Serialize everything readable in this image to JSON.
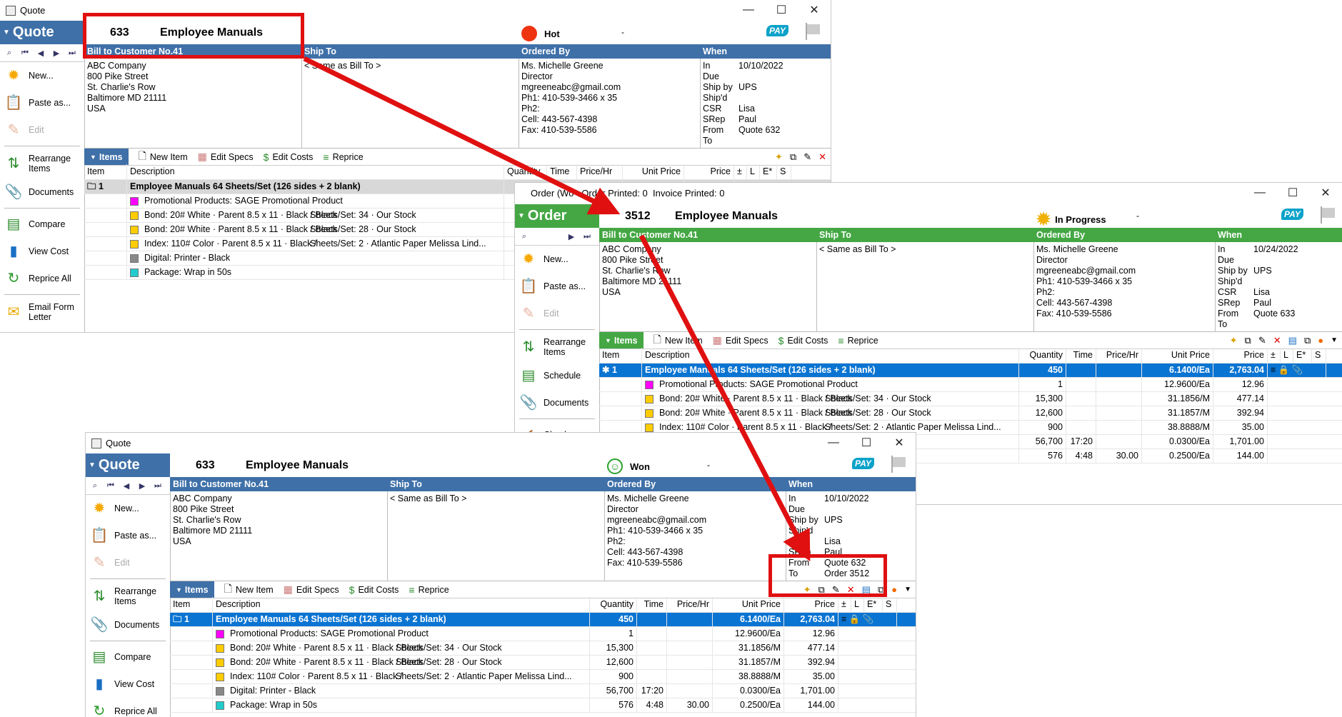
{
  "colors": {
    "quote_blue": "#3f70a8",
    "order_green": "#44a744",
    "annot_red": "#e01010",
    "sel_blue": "#0a74d2"
  },
  "quote_top": {
    "title": "Quote",
    "doc_label": "Quote",
    "number": "633",
    "job": "Employee Manuals",
    "status": "Hot",
    "status_icon": "red-circle-icon",
    "status_dash": "-",
    "pay": "PAY",
    "bill_to_header": "Bill to Customer No.41",
    "ship_to_header": "Ship To",
    "ordered_by_header": "Ordered By",
    "when_header": "When",
    "bill_to": [
      "ABC Company",
      "800 Pike Street",
      "St. Charlie's Row",
      "Baltimore MD 21111",
      "USA"
    ],
    "ship_to": "< Same as Bill To >",
    "ordered_by": [
      "Ms. Michelle Greene",
      "Director",
      "mgreeneabc@gmail.com",
      "Ph1: 410-539-3466 x 35",
      "Ph2:",
      "Cell: 443-567-4398",
      "Fax: 410-539-5586"
    ],
    "when": [
      [
        "In",
        "10/10/2022"
      ],
      [
        "Due",
        ""
      ],
      [
        "Ship by",
        "UPS"
      ],
      [
        "Ship'd",
        ""
      ],
      [
        "CSR",
        "Lisa"
      ],
      [
        "SRep",
        "Paul"
      ],
      [
        "From",
        "Quote 632"
      ],
      [
        "To",
        ""
      ]
    ],
    "toolbar": {
      "items": "Items",
      "new_item": "New Item",
      "edit_specs": "Edit Specs",
      "edit_costs": "Edit Costs",
      "reprice": "Reprice"
    },
    "columns": {
      "item": "Item",
      "description": "Description",
      "quantity": "Quantity",
      "time": "Time",
      "price_hr": "Price/Hr",
      "unit_price": "Unit Price",
      "price": "Price",
      "pm": "±",
      "l": "L",
      "e": "E*",
      "s": "S"
    },
    "rows": [
      {
        "item": "1",
        "desc": "Employee Manuals  64 Sheets/Set (126 sides + 2 blank)",
        "spec": "",
        "qty": "",
        "time": "",
        "phr": "",
        "unit": "",
        "price": "",
        "swatch": ""
      },
      {
        "item": "",
        "desc": "Promotional Products: SAGE Promotional Product",
        "spec": "",
        "qty": "",
        "time": "",
        "phr": "",
        "unit": "",
        "price": "",
        "swatch": "#ff00ff"
      },
      {
        "item": "",
        "desc": "Bond: 20# White · Parent 8.5 x 11 · Black / Black",
        "spec": "Sheets/Set: 34 · Our Stock",
        "qty": "",
        "time": "",
        "phr": "",
        "unit": "",
        "price": "",
        "swatch": "#ffcc00"
      },
      {
        "item": "",
        "desc": "Bond: 20# White · Parent 8.5 x 11 · Black / Black",
        "spec": "Sheets/Set: 28 · Our Stock",
        "qty": "",
        "time": "",
        "phr": "",
        "unit": "",
        "price": "",
        "swatch": "#ffcc00"
      },
      {
        "item": "",
        "desc": "Index: 110# Color · Parent 8.5 x 11 · Black /",
        "spec": "Sheets/Set: 2 · Atlantic Paper Melissa Lind...",
        "qty": "",
        "time": "",
        "phr": "",
        "unit": "",
        "price": "",
        "swatch": "#ffcc00"
      },
      {
        "item": "",
        "desc": "Digital: Printer - Black",
        "spec": "",
        "qty": "",
        "time": "",
        "phr": "",
        "unit": "",
        "price": "",
        "swatch": "#888888"
      },
      {
        "item": "",
        "desc": "Package: Wrap in  50s",
        "spec": "",
        "qty": "",
        "time": "",
        "phr": "",
        "unit": "",
        "price": "",
        "swatch": "#22cccc"
      }
    ],
    "side": [
      "New...",
      "Paste as...",
      "Edit",
      "Rearrange Items",
      "Documents",
      "Compare",
      "View Cost",
      "Reprice All",
      "Email Form Letter"
    ]
  },
  "order": {
    "partial_title": "Order (Wo",
    "printed": "Order Printed: 0",
    "invoice_printed": "Invoice Printed: 0",
    "doc_label": "Order",
    "number": "3512",
    "job": "Employee Manuals",
    "status": "In Progress",
    "status_dash": "-",
    "pay": "PAY",
    "bill_to_header": "Bill to Customer No.41",
    "ship_to_header": "Ship To",
    "ordered_by_header": "Ordered By",
    "when_header": "When",
    "bill_to": [
      "ABC Company",
      "800 Pike Street",
      "St. Charlie's Row",
      "Baltimore MD 21111",
      "USA"
    ],
    "ship_to": "< Same as Bill To >",
    "ordered_by": [
      "Ms. Michelle Greene",
      "Director",
      "mgreeneabc@gmail.com",
      "Ph1: 410-539-3466 x 35",
      "Ph2:",
      "Cell: 443-567-4398",
      "Fax: 410-539-5586"
    ],
    "when": [
      [
        "In",
        "10/24/2022"
      ],
      [
        "Due",
        ""
      ],
      [
        "Ship by",
        "UPS"
      ],
      [
        "Ship'd",
        ""
      ],
      [
        "CSR",
        "Lisa"
      ],
      [
        "SRep",
        "Paul"
      ],
      [
        "From",
        "Quote 633"
      ],
      [
        "To",
        ""
      ]
    ],
    "toolbar": {
      "items": "Items",
      "new_item": "New Item",
      "edit_specs": "Edit Specs",
      "edit_costs": "Edit Costs",
      "reprice": "Reprice"
    },
    "columns": {
      "item": "Item",
      "description": "Description",
      "quantity": "Quantity",
      "time": "Time",
      "price_hr": "Price/Hr",
      "unit_price": "Unit Price",
      "price": "Price",
      "pm": "±",
      "l": "L",
      "e": "E*",
      "s": "S"
    },
    "rows": [
      {
        "item": "1",
        "desc": "Employee Manuals  64 Sheets/Set (126 sides + 2 blank)",
        "spec": "",
        "qty": "450",
        "time": "",
        "phr": "",
        "unit": "6.1400/Ea",
        "price": "2,763.04",
        "swatch": ""
      },
      {
        "item": "",
        "desc": "Promotional Products: SAGE Promotional Product",
        "spec": "",
        "qty": "1",
        "time": "",
        "phr": "",
        "unit": "12.9600/Ea",
        "price": "12.96",
        "swatch": "#ff00ff"
      },
      {
        "item": "",
        "desc": "Bond: 20# White · Parent 8.5 x 11 · Black / Black",
        "spec": "Sheets/Set: 34 · Our Stock",
        "qty": "15,300",
        "time": "",
        "phr": "",
        "unit": "31.1856/M",
        "price": "477.14",
        "swatch": "#ffcc00"
      },
      {
        "item": "",
        "desc": "Bond: 20# White · Parent 8.5 x 11 · Black / Black",
        "spec": "Sheets/Set: 28 · Our Stock",
        "qty": "12,600",
        "time": "",
        "phr": "",
        "unit": "31.1857/M",
        "price": "392.94",
        "swatch": "#ffcc00"
      },
      {
        "item": "",
        "desc": "Index: 110# Color · Parent 8.5 x 11 · Black /",
        "spec": "Sheets/Set: 2 · Atlantic Paper Melissa Lind...",
        "qty": "900",
        "time": "",
        "phr": "",
        "unit": "38.8888/M",
        "price": "35.00",
        "swatch": "#ffcc00"
      },
      {
        "item": "",
        "desc": "",
        "spec": "",
        "qty": "56,700",
        "time": "17:20",
        "phr": "",
        "unit": "0.0300/Ea",
        "price": "1,701.00",
        "swatch": ""
      },
      {
        "item": "",
        "desc": "",
        "spec": "",
        "qty": "576",
        "time": "4:48",
        "phr": "30.00",
        "unit": "0.2500/Ea",
        "price": "144.00",
        "swatch": ""
      }
    ],
    "side": [
      "New...",
      "Paste as...",
      "Edit",
      "Rearrange Items",
      "Schedule",
      "Documents",
      "Check"
    ]
  },
  "quote_bottom": {
    "title": "Quote",
    "doc_label": "Quote",
    "number": "633",
    "job": "Employee Manuals",
    "status": "Won",
    "status_dash": "-",
    "pay": "PAY",
    "bill_to_header": "Bill to Customer No.41",
    "ship_to_header": "Ship To",
    "ordered_by_header": "Ordered By",
    "when_header": "When",
    "bill_to": [
      "ABC Company",
      "800 Pike Street",
      "St. Charlie's Row",
      "Baltimore MD 21111",
      "USA"
    ],
    "ship_to": "< Same as Bill To >",
    "ordered_by": [
      "Ms. Michelle Greene",
      "Director",
      "mgreeneabc@gmail.com",
      "Ph1: 410-539-3466 x 35",
      "Ph2:",
      "Cell: 443-567-4398",
      "Fax: 410-539-5586"
    ],
    "when": [
      [
        "In",
        "10/10/2022"
      ],
      [
        "Due",
        ""
      ],
      [
        "Ship by",
        "UPS"
      ],
      [
        "Ship'd",
        ""
      ],
      [
        "CSR",
        "Lisa"
      ],
      [
        "SRep",
        "Paul"
      ],
      [
        "From",
        "Quote 632"
      ],
      [
        "To",
        "Order 3512"
      ]
    ],
    "toolbar": {
      "items": "Items",
      "new_item": "New Item",
      "edit_specs": "Edit Specs",
      "edit_costs": "Edit Costs",
      "reprice": "Reprice"
    },
    "columns": {
      "item": "Item",
      "description": "Description",
      "quantity": "Quantity",
      "time": "Time",
      "price_hr": "Price/Hr",
      "unit_price": "Unit Price",
      "price": "Price",
      "pm": "±",
      "l": "L",
      "e": "E*",
      "s": "S"
    },
    "rows": [
      {
        "item": "1",
        "desc": "Employee Manuals  64 Sheets/Set (126 sides + 2 blank)",
        "spec": "",
        "qty": "450",
        "time": "",
        "phr": "",
        "unit": "6.1400/Ea",
        "price": "2,763.04",
        "swatch": ""
      },
      {
        "item": "",
        "desc": "Promotional Products: SAGE Promotional Product",
        "spec": "",
        "qty": "1",
        "time": "",
        "phr": "",
        "unit": "12.9600/Ea",
        "price": "12.96",
        "swatch": "#ff00ff"
      },
      {
        "item": "",
        "desc": "Bond: 20# White · Parent 8.5 x 11 · Black / Black",
        "spec": "Sheets/Set: 34 · Our Stock",
        "qty": "15,300",
        "time": "",
        "phr": "",
        "unit": "31.1856/M",
        "price": "477.14",
        "swatch": "#ffcc00"
      },
      {
        "item": "",
        "desc": "Bond: 20# White · Parent 8.5 x 11 · Black / Black",
        "spec": "Sheets/Set: 28 · Our Stock",
        "qty": "12,600",
        "time": "",
        "phr": "",
        "unit": "31.1857/M",
        "price": "392.94",
        "swatch": "#ffcc00"
      },
      {
        "item": "",
        "desc": "Index: 110# Color · Parent 8.5 x 11 · Black /",
        "spec": "Sheets/Set: 2 · Atlantic Paper Melissa Lind...",
        "qty": "900",
        "time": "",
        "phr": "",
        "unit": "38.8888/M",
        "price": "35.00",
        "swatch": "#ffcc00"
      },
      {
        "item": "",
        "desc": "Digital: Printer - Black",
        "spec": "",
        "qty": "56,700",
        "time": "17:20",
        "phr": "",
        "unit": "0.0300/Ea",
        "price": "1,701.00",
        "swatch": "#888888"
      },
      {
        "item": "",
        "desc": "Package: Wrap in  50s",
        "spec": "",
        "qty": "576",
        "time": "4:48",
        "phr": "30.00",
        "unit": "0.2500/Ea",
        "price": "144.00",
        "swatch": "#22cccc"
      }
    ],
    "side": [
      "New...",
      "Paste as...",
      "Edit",
      "Rearrange Items",
      "Documents",
      "Compare",
      "View Cost",
      "Reprice All"
    ]
  }
}
